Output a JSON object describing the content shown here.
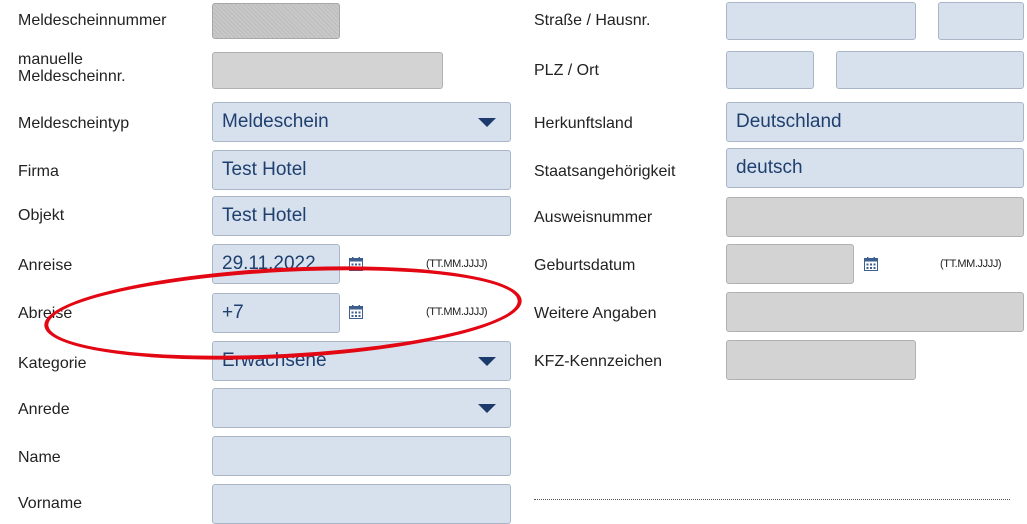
{
  "left": {
    "meldescheinnummer": {
      "label": "Meldescheinnummer",
      "value": ""
    },
    "manuelle_nr": {
      "label_line1": "manuelle",
      "label_line2": "Meldescheinnr.",
      "value": ""
    },
    "meldescheintyp": {
      "label": "Meldescheintyp",
      "value": "Meldeschein"
    },
    "firma": {
      "label": "Firma",
      "value": "Test Hotel"
    },
    "objekt": {
      "label": "Objekt",
      "value": "Test Hotel"
    },
    "anreise": {
      "label": "Anreise",
      "value": "29.11.2022",
      "format": "(TT.MM.JJJJ)"
    },
    "abreise": {
      "label": "Abreise",
      "value": "+7",
      "format": "(TT.MM.JJJJ)"
    },
    "kategorie": {
      "label": "Kategorie",
      "value": "Erwachsene"
    },
    "anrede": {
      "label": "Anrede",
      "value": ""
    },
    "name": {
      "label": "Name",
      "value": ""
    },
    "vorname": {
      "label": "Vorname",
      "value": ""
    }
  },
  "right": {
    "strasse": {
      "label": "Straße / Hausnr.",
      "value": "",
      "hausnr": ""
    },
    "plz_ort": {
      "label": "PLZ / Ort",
      "plz": "",
      "ort": ""
    },
    "herkunftsland": {
      "label": "Herkunftsland",
      "value": "Deutschland"
    },
    "staatsangehoerigkeit": {
      "label": "Staatsangehörigkeit",
      "value": "deutsch"
    },
    "ausweisnummer": {
      "label": "Ausweisnummer",
      "value": ""
    },
    "geburtsdatum": {
      "label": "Geburtsdatum",
      "value": "",
      "format": "(TT.MM.JJJJ)"
    },
    "weitere_angaben": {
      "label": "Weitere Angaben",
      "value": ""
    },
    "kfz_kennzeichen": {
      "label": "KFZ-Kennzeichen",
      "value": ""
    }
  },
  "icons": {
    "date_picker": "calendar-icon",
    "dropdown": "chevron-down-icon"
  },
  "colors": {
    "field_blue": "#d7e1ee",
    "field_grey": "#d3d3d3",
    "value_text": "#1f3f6e",
    "highlight": "#e30613"
  }
}
